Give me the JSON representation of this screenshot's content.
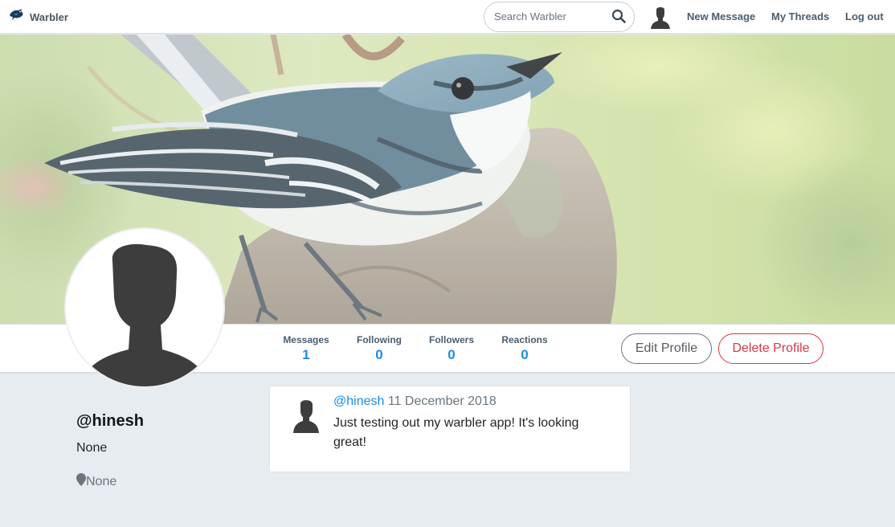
{
  "navbar": {
    "brand": "Warbler",
    "search_placeholder": "Search Warbler",
    "links": {
      "new_message": "New Message",
      "my_threads": "My Threads",
      "log_out": "Log out"
    }
  },
  "stats": {
    "messages": {
      "label": "Messages",
      "value": "1"
    },
    "following": {
      "label": "Following",
      "value": "0"
    },
    "followers": {
      "label": "Followers",
      "value": "0"
    },
    "reactions": {
      "label": "Reactions",
      "value": "0"
    }
  },
  "actions": {
    "edit_profile": "Edit Profile",
    "delete_profile": "Delete Profile"
  },
  "profile": {
    "username": "@hinesh",
    "bio": "None",
    "location": "None"
  },
  "messages": [
    {
      "user": "@hinesh",
      "date": "11 December 2018",
      "text": "Just testing out my warbler app! It's looking great!"
    }
  ],
  "colors": {
    "accent": "#1d8ce3",
    "danger": "#dc3545",
    "page_background": "#e6ecf0"
  },
  "icons": [
    "warbler-logo-icon",
    "search-icon",
    "user-avatar-icon",
    "map-pin-icon"
  ]
}
